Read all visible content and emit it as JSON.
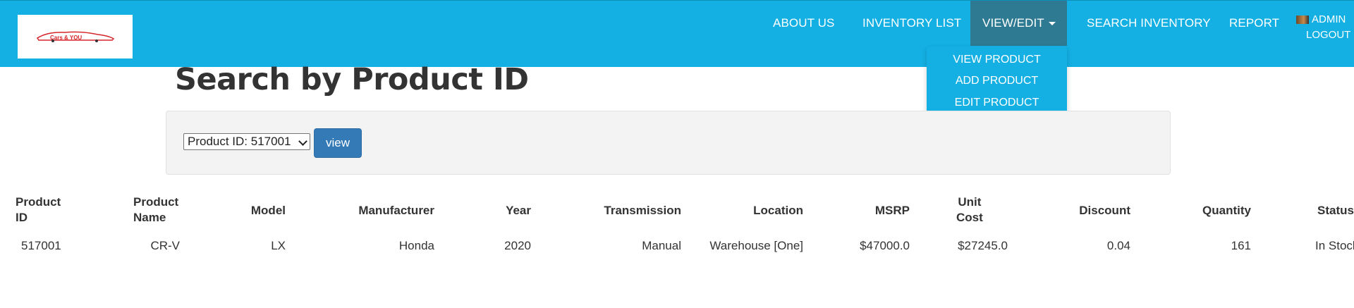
{
  "navbar": {
    "logo_text": "Cars & YOU",
    "links": [
      "ABOUT US",
      "INVENTORY LIST",
      "VIEW/EDIT",
      "SEARCH INVENTORY",
      "REPORT"
    ],
    "user": "ADMIN",
    "logout": "LOGOUT",
    "dropdown": [
      "VIEW PRODUCT",
      "ADD PRODUCT",
      "EDIT PRODUCT"
    ]
  },
  "page_title": "Search by Product ID",
  "search": {
    "select_value": "Product ID: 517001",
    "button": "view"
  },
  "table": {
    "headers": [
      "Product ID",
      "Product Name",
      "Model",
      "Manufacturer",
      "Year",
      "Transmission",
      "Location",
      "MSRP",
      "Unit Cost",
      "Discount",
      "Quantity",
      "Status"
    ],
    "header_lines": {
      "product_id": [
        "Product",
        "ID"
      ],
      "product_name": [
        "Product",
        "Name"
      ],
      "unit_cost": [
        "Unit",
        "Cost"
      ]
    },
    "row": [
      "517001",
      "CR-V",
      "LX",
      "Honda",
      "2020",
      "Manual",
      "Warehouse [One]",
      "$47000.0",
      "$27245.0",
      "0.04",
      "161",
      "In Stock"
    ]
  },
  "colors": {
    "navbar": "#14b0e4",
    "nav_active": "#2e7a93",
    "button": "#337ab7"
  }
}
